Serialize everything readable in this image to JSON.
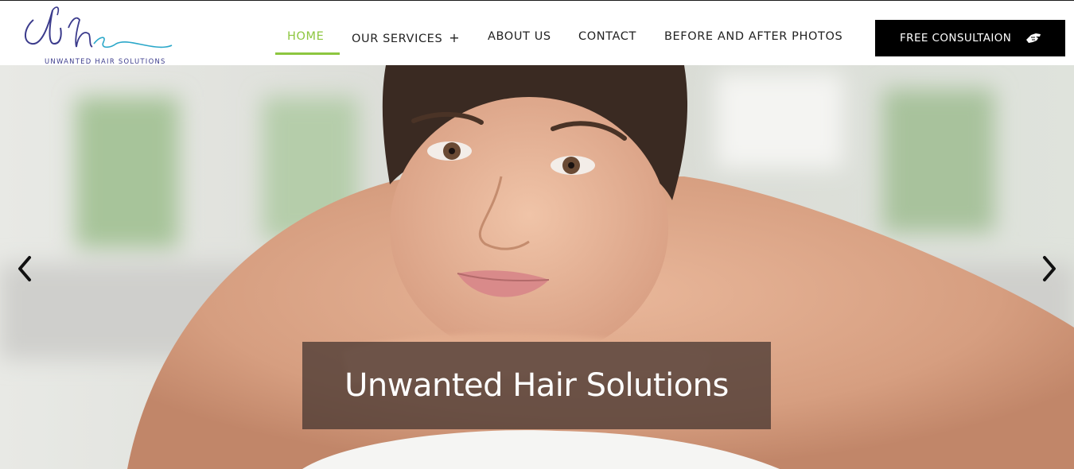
{
  "brand": {
    "logo_text": "UNWANTED HAIR SOLUTIONS",
    "logo_colors": [
      "#3b3b8c",
      "#2aa7c9"
    ]
  },
  "nav": {
    "items": [
      {
        "label": "HOME",
        "active": true
      },
      {
        "label": "OUR SERVICES",
        "has_submenu": true
      },
      {
        "label": "ABOUT US"
      },
      {
        "label": "CONTACT"
      },
      {
        "label": "BEFORE AND AFTER PHOTOS"
      }
    ],
    "submenu_icon": "plus-icon",
    "active_color": "#8dc63f"
  },
  "cta": {
    "label": "FREE CONSULTAION",
    "icon": "hand-pointer-icon"
  },
  "hero": {
    "caption": "Unwanted Hair Solutions",
    "prev_icon": "chevron-left-icon",
    "next_icon": "chevron-right-icon"
  }
}
